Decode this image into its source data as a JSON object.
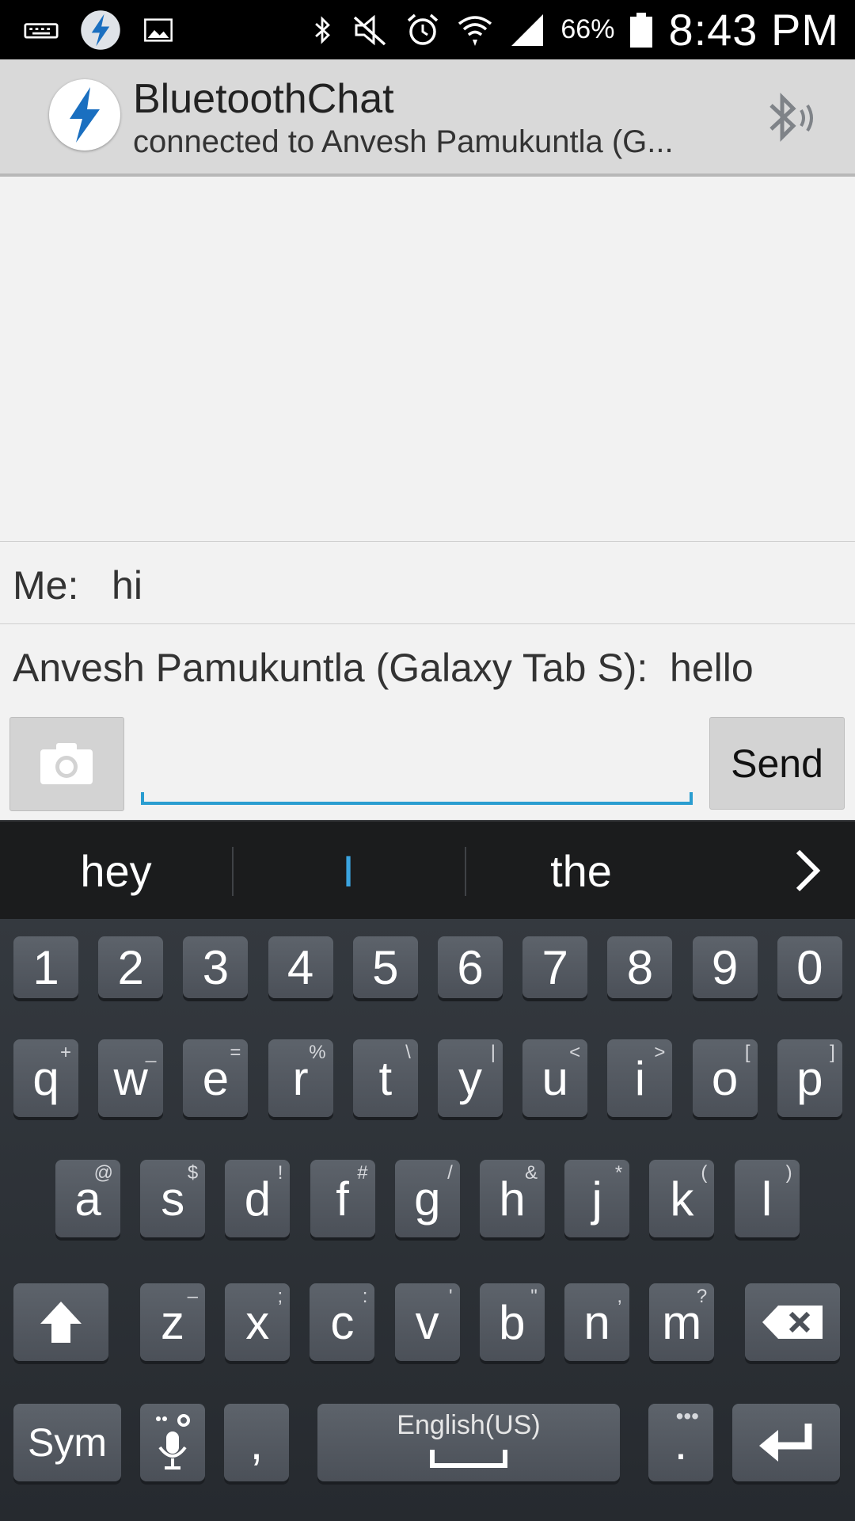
{
  "status_bar": {
    "battery": "66%",
    "time": "8:43 PM"
  },
  "action_bar": {
    "title": "BluetoothChat",
    "subtitle": "connected to Anvesh Pamukuntla (G..."
  },
  "conversation": {
    "messages": [
      {
        "text": "Me:   hi"
      },
      {
        "text": "Anvesh Pamukuntla (Galaxy Tab S):  hello"
      }
    ]
  },
  "compose": {
    "input_value": "",
    "send_label": "Send"
  },
  "suggestions": [
    "hey",
    "I",
    "the"
  ],
  "keyboard": {
    "number_row": [
      "1",
      "2",
      "3",
      "4",
      "5",
      "6",
      "7",
      "8",
      "9",
      "0"
    ],
    "row1": [
      {
        "k": "q",
        "a": "+"
      },
      {
        "k": "w",
        "a": "_"
      },
      {
        "k": "e",
        "a": "="
      },
      {
        "k": "r",
        "a": "%"
      },
      {
        "k": "t",
        "a": "\\"
      },
      {
        "k": "y",
        "a": "|"
      },
      {
        "k": "u",
        "a": "<"
      },
      {
        "k": "i",
        "a": ">"
      },
      {
        "k": "o",
        "a": "["
      },
      {
        "k": "p",
        "a": "]"
      }
    ],
    "row2": [
      {
        "k": "a",
        "a": "@"
      },
      {
        "k": "s",
        "a": "$"
      },
      {
        "k": "d",
        "a": "!"
      },
      {
        "k": "f",
        "a": "#"
      },
      {
        "k": "g",
        "a": "/"
      },
      {
        "k": "h",
        "a": "&"
      },
      {
        "k": "j",
        "a": "*"
      },
      {
        "k": "k",
        "a": "("
      },
      {
        "k": "l",
        "a": ")"
      }
    ],
    "row3": [
      {
        "k": "z",
        "a": "–"
      },
      {
        "k": "x",
        "a": ";"
      },
      {
        "k": "c",
        "a": ":"
      },
      {
        "k": "v",
        "a": "'"
      },
      {
        "k": "b",
        "a": "\""
      },
      {
        "k": "n",
        "a": ","
      },
      {
        "k": "m",
        "a": "?"
      }
    ],
    "sym_label": "Sym",
    "comma": ",",
    "space_label": "English(US)",
    "period": "."
  }
}
